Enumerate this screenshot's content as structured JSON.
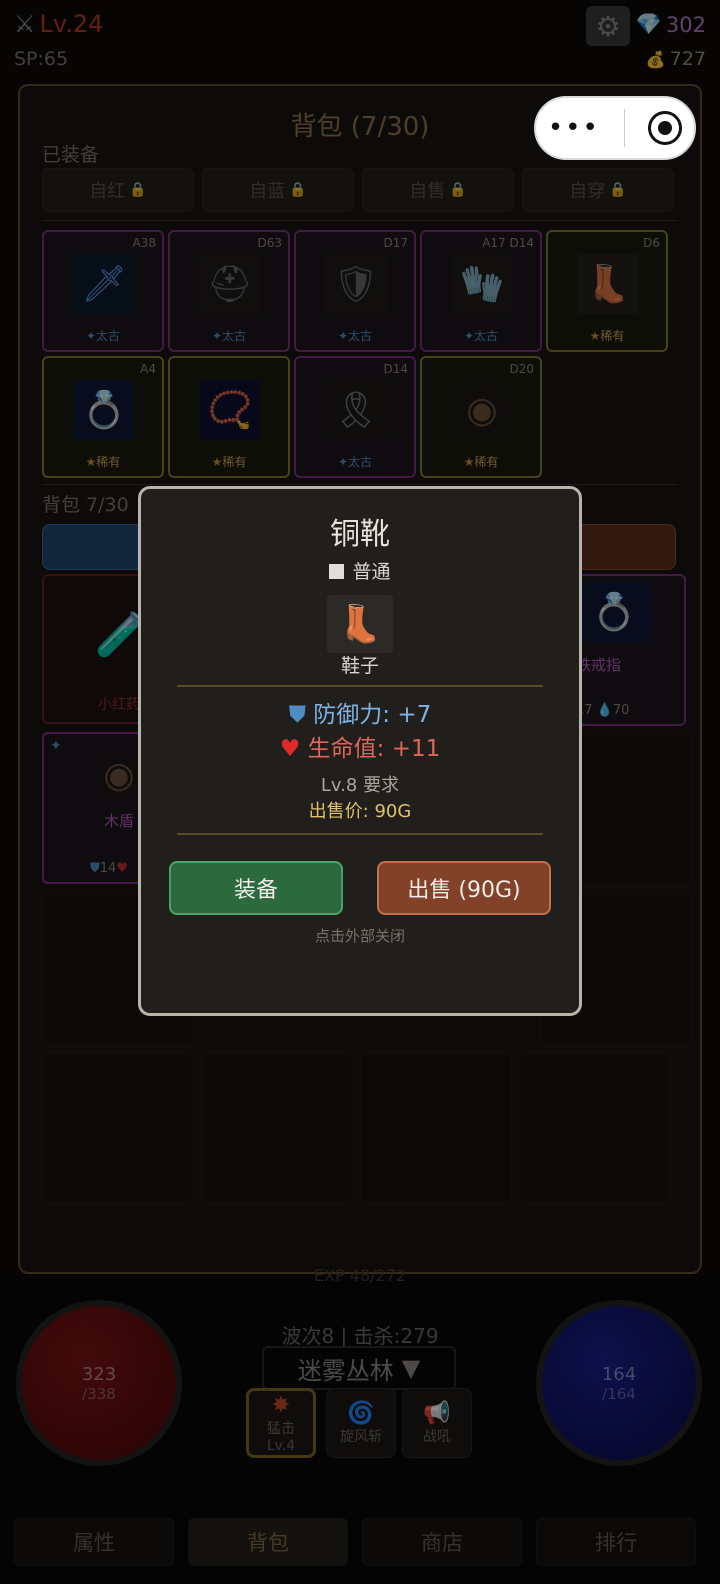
{
  "hud": {
    "level": "Lv.24",
    "sp": "SP:65",
    "gems": "302",
    "gold": "727",
    "swords_icon": "crossed-swords-icon",
    "gear_icon": "gear-icon",
    "gem_icon": "diamond-icon",
    "gold_icon": "money-bag-icon"
  },
  "inventory": {
    "title": "背包 (7/30)",
    "close": "X",
    "equipped_label": "已装备",
    "lock_buttons": [
      "自红",
      "自蓝",
      "自售",
      "自穿"
    ],
    "equipped": [
      {
        "stat": "A38",
        "rarity": "太古",
        "kind": "magic",
        "icon": "sword-icon"
      },
      {
        "stat": "D63",
        "rarity": "太古",
        "kind": "magic",
        "icon": "helmet-icon"
      },
      {
        "stat": "D17",
        "rarity": "太古",
        "kind": "magic",
        "icon": "armor-icon"
      },
      {
        "stat": "A17 D14",
        "rarity": "太古",
        "kind": "magic",
        "icon": "gloves-icon"
      },
      {
        "stat": "D6",
        "rarity": "稀有",
        "kind": "rare",
        "icon": "boots-icon"
      },
      {
        "stat": "A4",
        "rarity": "稀有",
        "kind": "rare",
        "icon": "ring-icon"
      },
      {
        "stat": "",
        "rarity": "稀有",
        "kind": "rare",
        "icon": "amulet-icon"
      },
      {
        "stat": "D14",
        "rarity": "太古",
        "kind": "magic",
        "icon": "belt-icon"
      },
      {
        "stat": "D20",
        "rarity": "稀有",
        "kind": "rare",
        "icon": "shield-icon"
      }
    ],
    "bag_label": "背包 7/30",
    "bag_items": [
      {
        "name": "小红药",
        "icon": "potion-icon"
      },
      {
        "name": "铁戒指",
        "stats": "17 💧70",
        "icon": "ring-icon"
      },
      {
        "name": "木盾",
        "stats": "14",
        "icon": "shield-icon"
      }
    ]
  },
  "modal": {
    "title": "铜靴",
    "rarity": "普通",
    "type": "鞋子",
    "defense_label": "防御力: +7",
    "hp_label": "生命值: +11",
    "requirement": "Lv.8 要求",
    "sell_price": "出售价: 90G",
    "equip_button": "装备",
    "sell_button": "出售 (90G)",
    "close_hint": "点击外部关闭",
    "colors": {
      "defense": "#7fb0e6",
      "hp": "#e0665c",
      "price": "#e2c06a"
    }
  },
  "bottom": {
    "exp": "EXP 48/272",
    "hp_current": "323",
    "hp_max": "/338",
    "mp_current": "164",
    "mp_max": "/164",
    "wave": "波次8 | 击杀:279",
    "zone": "迷雾丛林",
    "zone_arrow": "▼",
    "skills": [
      {
        "name": "猛击",
        "level": "Lv.4",
        "icon": "burst-icon"
      },
      {
        "name": "旋风斩",
        "icon": "whirlwind-icon"
      },
      {
        "name": "战吼",
        "icon": "megaphone-icon"
      }
    ],
    "tabs": [
      "属性",
      "背包",
      "商店",
      "排行"
    ]
  }
}
